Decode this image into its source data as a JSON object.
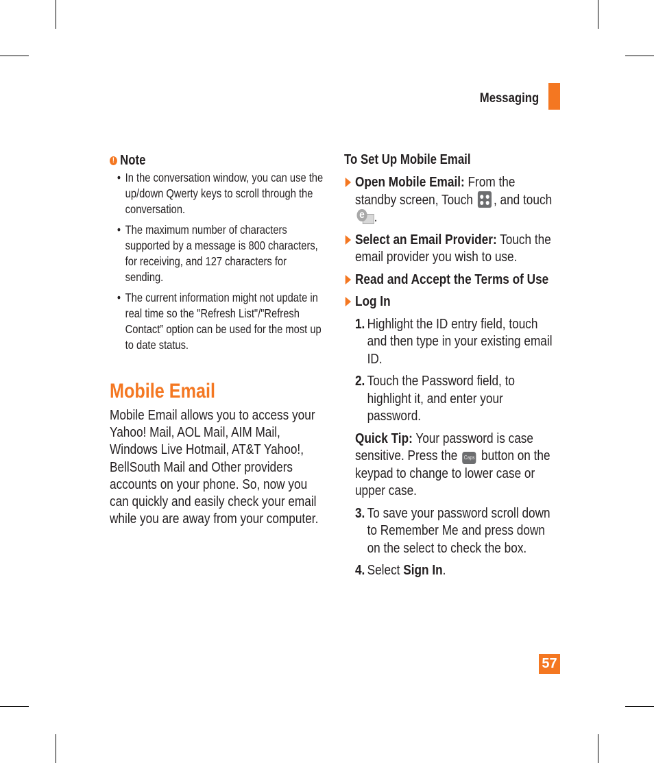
{
  "header": {
    "section": "Messaging",
    "accent_color": "#f47721"
  },
  "note": {
    "title": "Note",
    "icon": "exclamation-circle-icon",
    "items": [
      "In the conversation window, you can use the up/down Qwerty keys to scroll through the conversation.",
      "The maximum number of characters supported by a message is 800 characters, for receiving, and 127 characters for sending.",
      "The current information might not update in real time so the \"Refresh List\"/\"Refresh Contact” option can be used for the most up to date status."
    ]
  },
  "main": {
    "title": "Mobile Email",
    "intro": "Mobile Email allows you to access your Yahoo! Mail, AOL Mail, AIM Mail, Windows Live Hotmail, AT&T Yahoo!, BellSouth Mail and Other providers accounts on your phone. So, now you can quickly and easily check your email while you are away from your computer."
  },
  "setup": {
    "title": "To Set Up Mobile Email",
    "steps": [
      {
        "label": "Open Mobile Email:",
        "text_before": " From the standby screen, Touch ",
        "icon1": "menu-icon",
        "text_middle": ", and touch ",
        "icon2": "mobile-email-icon",
        "text_after": "."
      },
      {
        "label": "Select an Email Provider:",
        "text": " Touch the email provider you wish to use."
      },
      {
        "label": "Read and Accept the Terms of Use"
      },
      {
        "label": "Log In"
      }
    ],
    "login_steps": [
      {
        "num": "1.",
        "text": "Highlight the ID entry field, touch and then type in your existing email ID."
      },
      {
        "num": "2.",
        "text": "Touch the Password field, to highlight it, and enter your password."
      }
    ],
    "quick_tip": {
      "label": "Quick Tip:",
      "text_before": " Your password is case sensitive. Press the ",
      "button_label": "Caps",
      "text_after": " button on the keypad to change to lower case or upper case."
    },
    "login_steps_2": [
      {
        "num": "3.",
        "text": "To save your password scroll down to Remember Me and press down on the select to check the box."
      },
      {
        "num": "4.",
        "text_before": "Select ",
        "bold": "Sign In",
        "text_after": "."
      }
    ]
  },
  "footer": {
    "page_number": "57"
  }
}
